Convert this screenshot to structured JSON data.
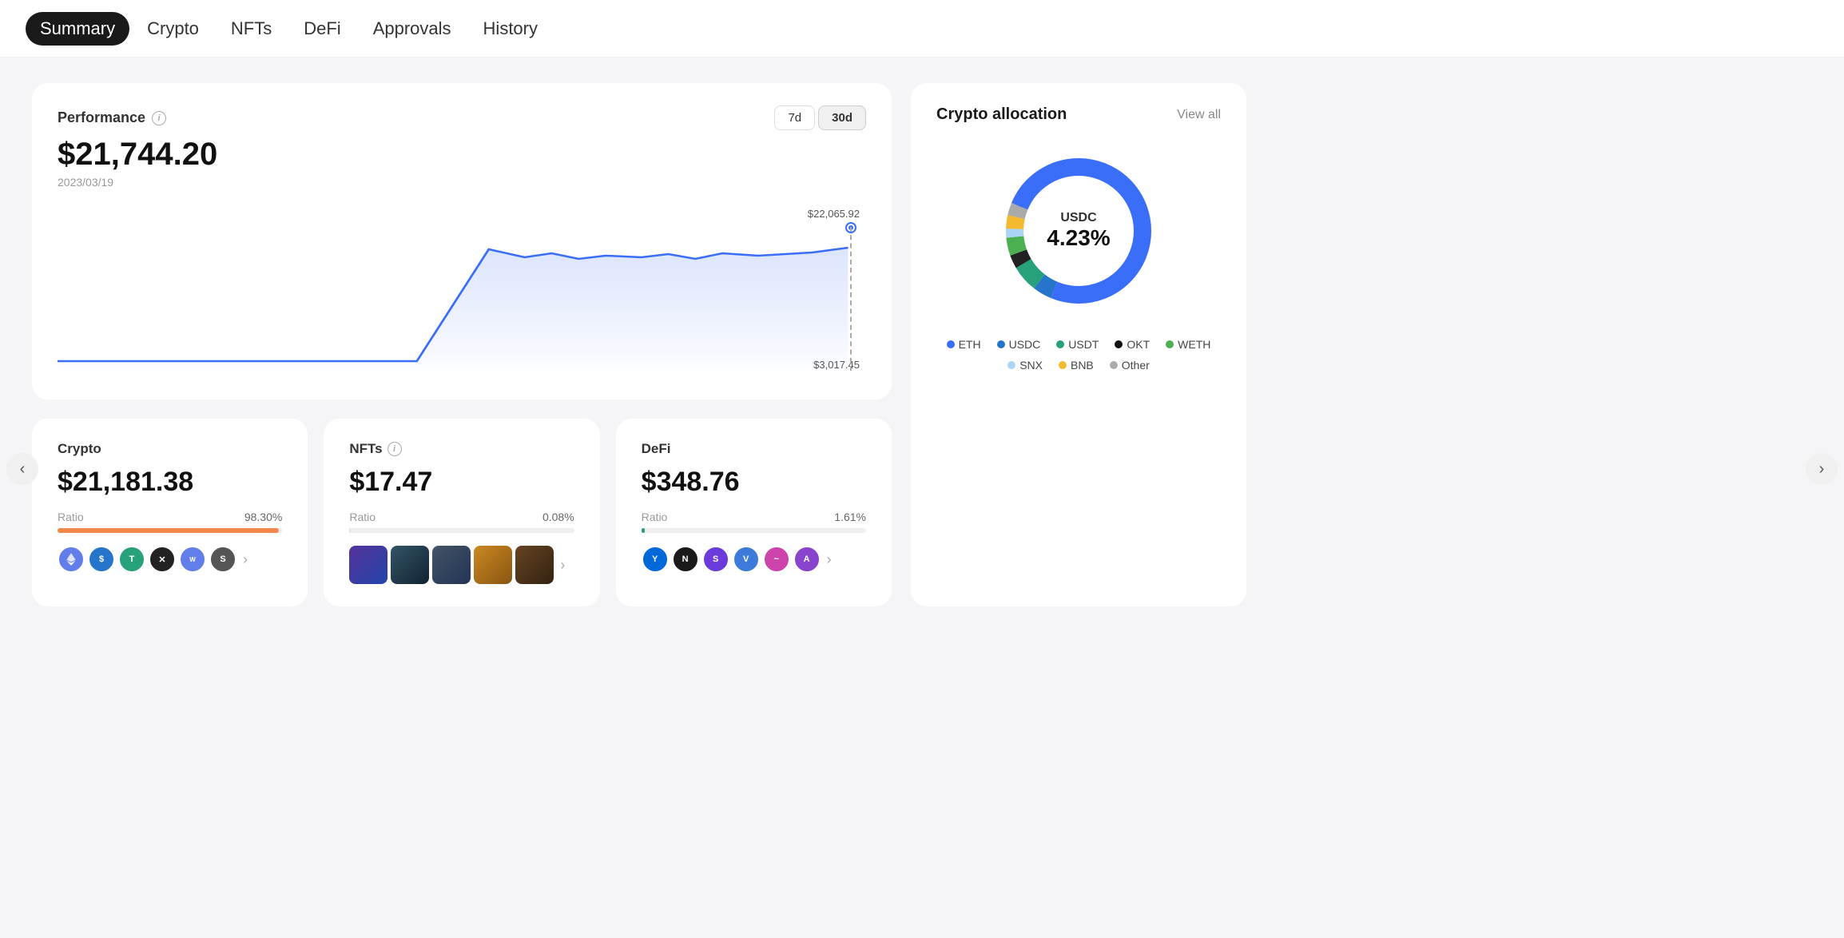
{
  "nav": {
    "items": [
      {
        "id": "summary",
        "label": "Summary",
        "active": true
      },
      {
        "id": "crypto",
        "label": "Crypto",
        "active": false
      },
      {
        "id": "nfts",
        "label": "NFTs",
        "active": false
      },
      {
        "id": "defi",
        "label": "DeFi",
        "active": false
      },
      {
        "id": "approvals",
        "label": "Approvals",
        "active": false
      },
      {
        "id": "history",
        "label": "History",
        "active": false
      }
    ]
  },
  "performance": {
    "title": "Performance",
    "amount": "$21,744.20",
    "date": "2023/03/19",
    "high_label": "$22,065.92",
    "low_label": "$3,017.45",
    "time_buttons": [
      "7d",
      "30d"
    ],
    "active_time": "30d"
  },
  "allocation": {
    "title": "Crypto allocation",
    "view_all": "View all",
    "center_label": "USDC",
    "center_pct": "4.23%",
    "legend": [
      {
        "label": "ETH",
        "color": "#3b6ef8"
      },
      {
        "label": "USDC",
        "color": "#2775ca"
      },
      {
        "label": "USDT",
        "color": "#26a17b"
      },
      {
        "label": "OKT",
        "color": "#111"
      },
      {
        "label": "WETH",
        "color": "#4caf50"
      },
      {
        "label": "SNX",
        "color": "#aad4f5"
      },
      {
        "label": "BNB",
        "color": "#f3ba2f"
      },
      {
        "label": "Other",
        "color": "#aaa"
      }
    ],
    "donut_segments": [
      {
        "color": "#3b6ef8",
        "pct": 75
      },
      {
        "color": "#2775ca",
        "pct": 4.23
      },
      {
        "color": "#26a17b",
        "pct": 6
      },
      {
        "color": "#111",
        "pct": 3
      },
      {
        "color": "#4caf50",
        "pct": 4
      },
      {
        "color": "#aad4f5",
        "pct": 2
      },
      {
        "color": "#f3ba2f",
        "pct": 3
      },
      {
        "color": "#aaa",
        "pct": 2.77
      }
    ]
  },
  "crypto_card": {
    "title": "Crypto",
    "amount": "$21,181.38",
    "ratio_label": "Ratio",
    "ratio_pct": "98.30%",
    "bar_color": "#f4874b",
    "bar_fill": 98.3,
    "tokens": [
      {
        "label": "ETH",
        "color": "#627eea"
      },
      {
        "label": "$",
        "color": "#2775ca"
      },
      {
        "label": "T",
        "color": "#26a17b"
      },
      {
        "label": "×",
        "color": "#333"
      },
      {
        "label": "W",
        "color": "#627eea"
      },
      {
        "label": "S",
        "color": "#444"
      }
    ]
  },
  "nfts_card": {
    "title": "NFTs",
    "amount": "$17.47",
    "ratio_label": "Ratio",
    "ratio_pct": "0.08%",
    "bar_color": "#ddd",
    "bar_fill": 0.08
  },
  "defi_card": {
    "title": "DeFi",
    "amount": "$348.76",
    "ratio_label": "Ratio",
    "ratio_pct": "1.61%",
    "bar_color": "#26a17b",
    "bar_fill": 1.61,
    "tokens": [
      {
        "label": "Y",
        "color": "#0068d9"
      },
      {
        "label": "N",
        "color": "#2a2a2a"
      },
      {
        "label": "S",
        "color": "#6c3bdb"
      },
      {
        "label": "V",
        "color": "#3d7bdb"
      },
      {
        "label": "~",
        "color": "#cc44aa"
      },
      {
        "label": "A",
        "color": "#8844cc"
      }
    ]
  }
}
